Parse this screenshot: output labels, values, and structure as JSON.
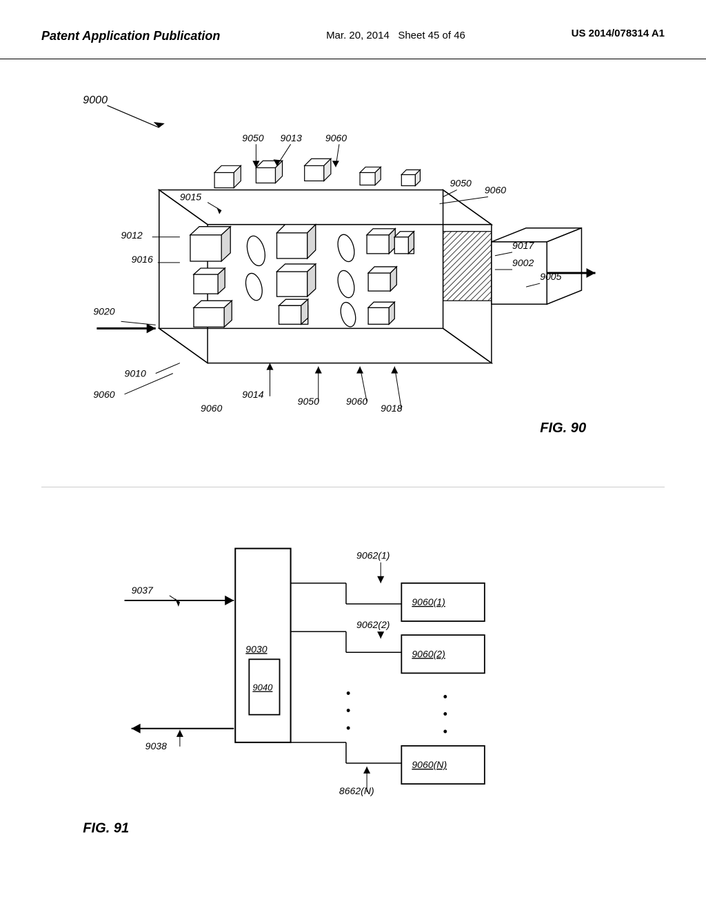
{
  "header": {
    "left_label": "Patent Application Publication",
    "center_date": "Mar. 20, 2014",
    "center_sheet": "Sheet 45 of 46",
    "right_patent": "US 2014/078314 A1"
  },
  "fig90": {
    "label": "FIG. 90",
    "reference_numbers": {
      "9000": "9000",
      "9002": "9002",
      "9005": "9005",
      "9010": "9010",
      "9012": "9012",
      "9013": "9013",
      "9014": "9014",
      "9015": "9015",
      "9016": "9016",
      "9017": "9017",
      "9018": "9018",
      "9020": "9020",
      "9050_1": "9050",
      "9050_2": "9050",
      "9050_3": "9050",
      "9060_1": "9060",
      "9060_2": "9060",
      "9060_3": "9060",
      "9060_4": "9060"
    }
  },
  "fig91": {
    "label": "FIG. 91",
    "reference_numbers": {
      "9030": "9030",
      "9037": "9037",
      "9038": "9038",
      "9040": "9040",
      "9060_1": "9060(1)",
      "9060_2": "9060(2)",
      "9060_N": "9060(N)",
      "9062_1": "9062(1)",
      "9062_2": "9062(2)",
      "8662_N": "8662(N)"
    }
  }
}
